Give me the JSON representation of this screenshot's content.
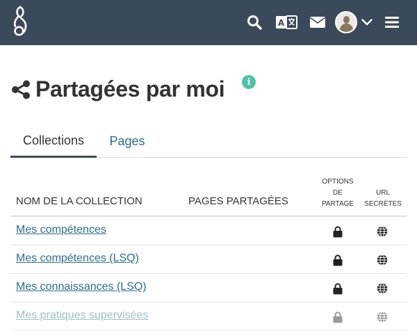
{
  "header": {
    "icons": [
      "mahara-logo-icon",
      "search-icon",
      "language-icon",
      "mail-icon",
      "avatar",
      "chevron-down-icon",
      "hamburger-menu-icon"
    ],
    "background": "#3b4a5a"
  },
  "page": {
    "title": "Partagées par moi",
    "info_icon": "i"
  },
  "tabs": [
    {
      "label": "Collections",
      "active": true
    },
    {
      "label": "Pages",
      "active": false
    }
  ],
  "table": {
    "headers": {
      "name": "NOM DE LA COLLECTION",
      "pages": "PAGES PARTAGÉES",
      "options": "OPTIONS DE PARTAGE",
      "url": "URL SECRÈTES"
    },
    "rows": [
      {
        "name": "Mes compétences",
        "options_icon": "lock-icon",
        "url_icon": "globe-icon"
      },
      {
        "name": "Mes compétences (LSQ)",
        "options_icon": "lock-icon",
        "url_icon": "globe-icon"
      },
      {
        "name": "Mes connaissances (LSQ)",
        "options_icon": "lock-icon",
        "url_icon": "globe-icon"
      },
      {
        "name": "Mes pratiques supervisées",
        "options_icon": "lock-icon",
        "url_icon": "globe-icon"
      }
    ]
  },
  "colors": {
    "accent": "#3b4a5a",
    "link": "#2b6d8a",
    "info": "#4ec3a6"
  }
}
